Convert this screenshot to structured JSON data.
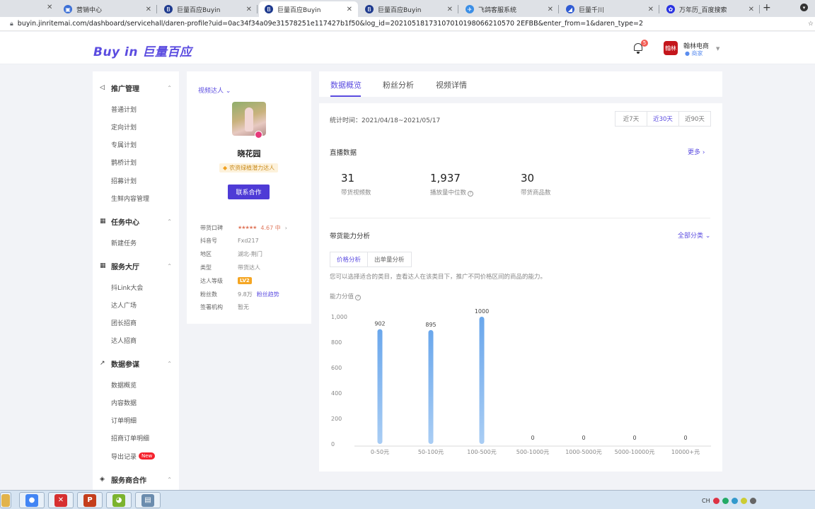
{
  "browser": {
    "tabs": [
      {
        "title": "营销中心",
        "active": false,
        "icon_color": "#3b6fd6",
        "glyph": "▣"
      },
      {
        "title": "巨量百应Buyin",
        "active": false,
        "icon_color": "#1f3b8f",
        "glyph": "B"
      },
      {
        "title": "巨量百应Buyin",
        "active": true,
        "icon_color": "#1f3b8f",
        "glyph": "B"
      },
      {
        "title": "巨量百应Buyin",
        "active": false,
        "icon_color": "#1f3b8f",
        "glyph": "B"
      },
      {
        "title": "飞鸽客服系统",
        "active": false,
        "icon_color": "#3a8ee6",
        "glyph": "✈"
      },
      {
        "title": "巨量千川",
        "active": false,
        "icon_color": "#2f5bd3",
        "glyph": "◢"
      },
      {
        "title": "万年历_百度搜索",
        "active": false,
        "icon_color": "#2932e1",
        "glyph": "✿"
      }
    ],
    "url": "buyin.jinritemai.com/dashboard/servicehall/daren-profile?uid=0ac34f34a09e31578251e117427b1f50&log_id=20210518173107010198066210570 2EFBB&enter_from=1&daren_type=2"
  },
  "header": {
    "logo": "Buy in 巨量百应",
    "notification_count": "5",
    "shop_avatar_text": "翰林",
    "shop_name": "翰林电商",
    "shop_role": "商家"
  },
  "nav": {
    "groups": [
      {
        "label": "推广管理",
        "icon": "megaphone-icon",
        "items": [
          "普通计划",
          "定向计划",
          "专属计划",
          "鹊桥计划",
          "招募计划",
          "生鲜内容管理"
        ]
      },
      {
        "label": "任务中心",
        "icon": "grid-icon",
        "items": [
          "新建任务"
        ]
      },
      {
        "label": "服务大厅",
        "icon": "grid-icon",
        "items": [
          "抖Link大会",
          "达人广场",
          "团长招商",
          "达人招商"
        ]
      },
      {
        "label": "数据参谋",
        "icon": "chart-icon",
        "items": [
          "数据概览",
          "内容数据",
          "订单明细",
          "招商订单明细",
          "导出记录"
        ]
      },
      {
        "label": "服务商合作",
        "icon": "shield-icon",
        "items": []
      }
    ],
    "new_badge": "New"
  },
  "profile": {
    "role_select": "视频达人",
    "name": "晓花园",
    "tag": "农资绿植潜力达人",
    "contact_button": "联系合作",
    "rows": [
      {
        "key": "带货口碑",
        "value": "4.67 中"
      },
      {
        "key": "抖音号",
        "value": "Fxd217"
      },
      {
        "key": "地区",
        "value": "湖北-荆门"
      },
      {
        "key": "类型",
        "value": "带货达人"
      },
      {
        "key": "达人等级",
        "value": "LV2"
      },
      {
        "key": "粉丝数",
        "value": "9.8万",
        "extra": "粉丝趋势"
      },
      {
        "key": "签署机构",
        "value": "暂无"
      }
    ]
  },
  "main": {
    "tabs": [
      "数据概览",
      "粉丝分析",
      "视频详情"
    ],
    "active_tab": "数据概览",
    "stat_time": "统计时间：2021/04/18~2021/05/17",
    "ranges": [
      "近7天",
      "近30天",
      "近90天"
    ],
    "active_range": "近30天",
    "live_title": "直播数据",
    "more": "更多",
    "metrics": [
      {
        "value": "31",
        "label": "带货视频数"
      },
      {
        "value": "1,937",
        "label": "播放量中位数"
      },
      {
        "value": "30",
        "label": "带货商品数"
      }
    ],
    "ability_title": "带货能力分析",
    "all_categories": "全部分类",
    "segments": [
      "价格分析",
      "出单量分析"
    ],
    "active_segment": "价格分析",
    "hint": "您可以选择适合的类目，查看达人在该类目下，推广不同价格区间的商品的能力。",
    "score_label": "能力分值"
  },
  "chart_data": {
    "type": "bar",
    "categories": [
      "0-50元",
      "50-100元",
      "100-500元",
      "500-1000元",
      "1000-5000元",
      "5000-10000元",
      "10000+元"
    ],
    "values": [
      902,
      895,
      1000,
      0,
      0,
      0,
      0
    ],
    "data_labels": [
      "902",
      "895",
      "1000",
      "0",
      "0",
      "0",
      "0"
    ],
    "ylim": [
      0,
      1000
    ],
    "yticks": [
      "1,000",
      "800",
      "600",
      "400",
      "200",
      "0"
    ],
    "ytick_values": [
      1000,
      800,
      600,
      400,
      200,
      0
    ],
    "bar_color": "#6aa7ec",
    "bar_color_light": "#a9cdf4"
  },
  "taskbar": {
    "apps": [
      {
        "name": "chrome",
        "color": "#4285f4",
        "glyph": "●"
      },
      {
        "name": "xmind",
        "color": "#d63031",
        "glyph": "✕"
      },
      {
        "name": "powerpoint",
        "color": "#c43e1c",
        "glyph": "P"
      },
      {
        "name": "wechat",
        "color": "#7bb32e",
        "glyph": "◕"
      },
      {
        "name": "notepad",
        "color": "#6b8cae",
        "glyph": "▤"
      }
    ],
    "tray_text": "CH"
  }
}
